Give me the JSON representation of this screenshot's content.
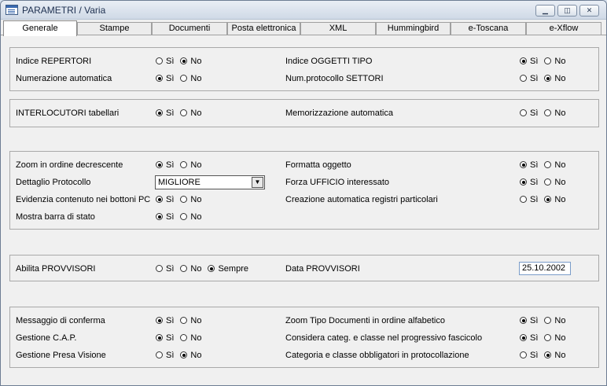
{
  "window": {
    "title": "PARAMETRI / Varia"
  },
  "tabs": [
    "Generale",
    "Stampe",
    "Documenti",
    "Posta elettronica",
    "XML",
    "Hummingbird",
    "e-Toscana",
    "e-Xflow"
  ],
  "yes_label": "Sì",
  "no_label": "No",
  "always_label": "Sempre",
  "groups": {
    "g1": {
      "indice_repertori": {
        "label": "Indice REPERTORI",
        "selected": "No"
      },
      "numerazione_automatica": {
        "label": "Numerazione automatica",
        "selected": "Sì"
      },
      "indice_oggetti_tipo": {
        "label": "Indice OGGETTI TIPO",
        "selected": "Sì"
      },
      "num_protocollo_settori": {
        "label": "Num.protocollo SETTORI",
        "selected": "No"
      }
    },
    "g2": {
      "interlocutori_tabellari": {
        "label": "INTERLOCUTORI tabellari",
        "selected": "Sì"
      },
      "memorizzazione_automatica": {
        "label": "Memorizzazione automatica",
        "selected": "none"
      }
    },
    "g3": {
      "zoom_decrescente": {
        "label": "Zoom in ordine decrescente",
        "selected": "Sì"
      },
      "dettaglio_protocollo": {
        "label": "Dettaglio Protocollo",
        "value": "MIGLIORE"
      },
      "evidenzia_contenuto": {
        "label": "Evidenzia contenuto nei bottoni PC",
        "selected": "Sì"
      },
      "mostra_barra": {
        "label": "Mostra barra di stato",
        "selected": "Sì"
      },
      "formatta_oggetto": {
        "label": "Formatta oggetto",
        "selected": "Sì"
      },
      "forza_ufficio": {
        "label": "Forza UFFICIO interessato",
        "selected": "Sì"
      },
      "creazione_registri": {
        "label": "Creazione automatica registri particolari",
        "selected": "No"
      }
    },
    "g4": {
      "abilita_provvisori": {
        "label": "Abilita PROVVISORI",
        "selected": "Sempre"
      },
      "data_provvisori": {
        "label": "Data PROVVISORI",
        "value": "25.10.2002"
      }
    },
    "g5": {
      "messaggio_conferma": {
        "label": "Messaggio di conferma",
        "selected": "Sì"
      },
      "gestione_cap": {
        "label": "Gestione C.A.P.",
        "selected": "Sì"
      },
      "gestione_presa_visione": {
        "label": "Gestione Presa Visione",
        "selected": "No"
      },
      "zoom_tipo_documenti": {
        "label": "Zoom Tipo Documenti in ordine alfabetico",
        "selected": "Sì"
      },
      "considera_categ": {
        "label": "Considera categ. e classe nel progressivo fascicolo",
        "selected": "Sì"
      },
      "categoria_classe": {
        "label": "Categoria e classe obbligatori in protocollazione",
        "selected": "No"
      }
    }
  }
}
